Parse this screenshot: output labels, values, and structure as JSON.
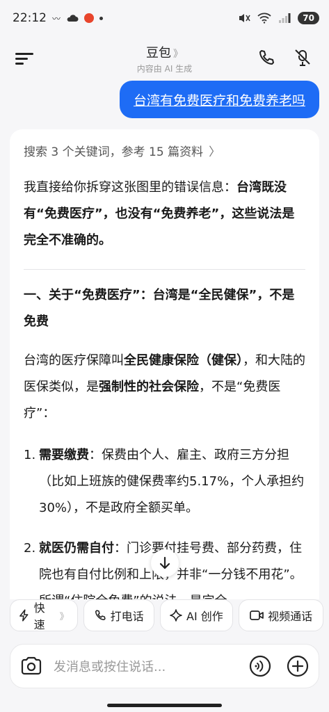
{
  "status_bar": {
    "time": "22:12",
    "battery": "70"
  },
  "header": {
    "title": "豆包",
    "chevron": "》",
    "subtitle": "内容由 AI 生成"
  },
  "user_message": "台湾有免费医疗和免费养老吗",
  "answer": {
    "search_ref": "搜索 3 个关键词，参考 15 篇资料",
    "intro_plain": "我直接给你拆穿这张图里的错误信息：",
    "intro_bold": "台湾既没有“免费医疗”，也没有“免费养老”，这些说法是完全不准确的。",
    "section1_heading": "一、关于“免费医疗”：台湾是“全民健保”，不是免费",
    "p2_a": "台湾的医疗保障叫",
    "p2_b": "全民健康保险（健保）",
    "p2_c": "，和大陆的医保类似，是",
    "p2_d": "强制性的社会保险",
    "p2_e": "，不是“免费医疗”：",
    "items": [
      {
        "num": "1.",
        "title": "需要缴费",
        "text": "：保费由个人、雇主、政府三方分担（比如上班族的健保费率约5.17%，个人承担约30%），不是政府全额买单。"
      },
      {
        "num": "2.",
        "title": "就医仍需自付",
        "text": "：门诊要付挂号费、部分药费，住院也有自付比例和上限，并非“一分钱不用花”。所谓“住院全免费”的说法，是完全"
      }
    ]
  },
  "quick_actions": [
    {
      "label": "快速",
      "icon": "lightning-icon",
      "chevron": "》"
    },
    {
      "label": "打电话",
      "icon": "phone-icon"
    },
    {
      "label": "AI 创作",
      "icon": "sparkle-icon"
    },
    {
      "label": "视频通话",
      "icon": "video-icon"
    }
  ],
  "input": {
    "placeholder": "发消息或按住说话..."
  },
  "colors": {
    "accent": "#1e6cf5",
    "background": "#f6f6f8"
  }
}
